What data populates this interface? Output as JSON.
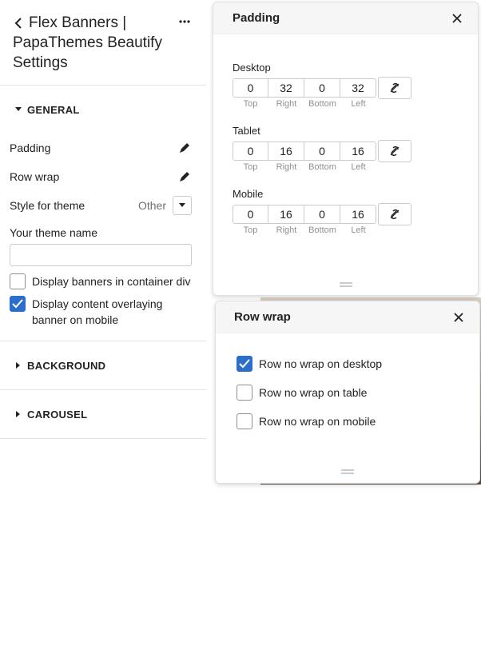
{
  "sidebar": {
    "title_line1": "Flex Banners |",
    "title_line2": "PapaThemes Beautify",
    "title_line3": "Settings",
    "sections": {
      "general": {
        "title": "GENERAL",
        "padding_label": "Padding",
        "row_wrap_label": "Row wrap",
        "style_label": "Style for theme",
        "style_value": "Other",
        "theme_name_label": "Your theme name",
        "theme_name_value": "",
        "display_container_label": "Display banners in container div",
        "display_container_checked": false,
        "overlay_label": "Display content overlaying banner on mobile",
        "overlay_checked": true
      },
      "background": {
        "title": "BACKGROUND"
      },
      "carousel": {
        "title": "CAROUSEL"
      }
    }
  },
  "padding_popover": {
    "title": "Padding",
    "sub_labels": {
      "top": "Top",
      "right": "Right",
      "bottom": "Bottom",
      "left": "Left"
    },
    "desktop": {
      "label": "Desktop",
      "top": "0",
      "right": "32",
      "bottom": "0",
      "left": "32"
    },
    "tablet": {
      "label": "Tablet",
      "top": "0",
      "right": "16",
      "bottom": "0",
      "left": "16"
    },
    "mobile": {
      "label": "Mobile",
      "top": "0",
      "right": "16",
      "bottom": "0",
      "left": "16"
    }
  },
  "row_wrap_popover": {
    "title": "Row wrap",
    "items": [
      {
        "label": "Row no wrap on desktop",
        "checked": true
      },
      {
        "label": "Row no wrap on table",
        "checked": false
      },
      {
        "label": "Row no wrap on mobile",
        "checked": false
      }
    ]
  },
  "colors": {
    "accent": "#2c6ecb",
    "text": "#202223",
    "muted": "#8c9196",
    "border": "#c9cccf"
  },
  "icons": [
    "chevron-left-icon",
    "more-horizontal-icon",
    "caret-down-icon",
    "caret-right-icon",
    "pencil-icon",
    "select-arrow-icon",
    "checkmark-icon",
    "close-icon",
    "link-icon",
    "drag-handle-icon"
  ]
}
